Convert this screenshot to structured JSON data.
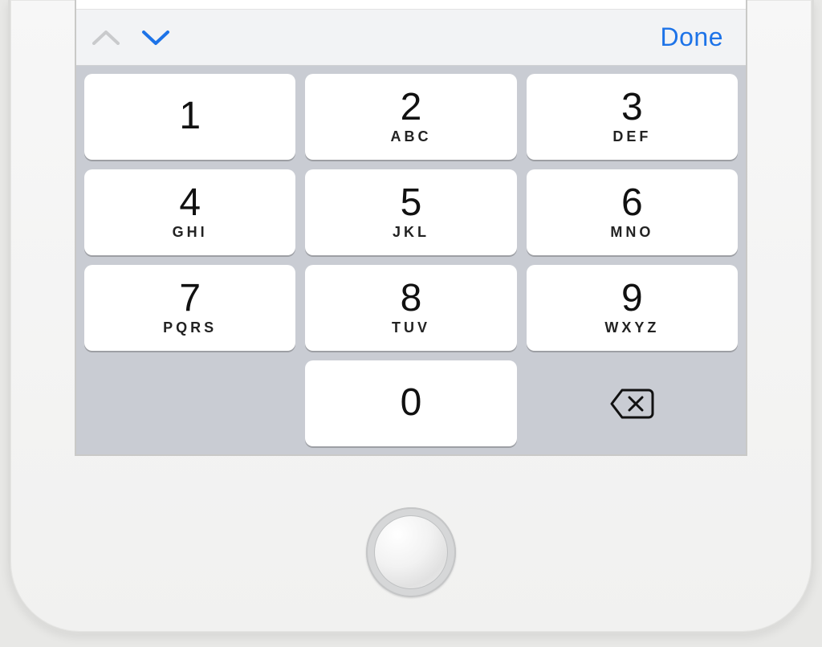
{
  "accessory": {
    "prev_icon": "chevron-up-icon",
    "next_icon": "chevron-down-icon",
    "done_label": "Done",
    "accent_color": "#1d73e8"
  },
  "keypad": {
    "keys": [
      {
        "digit": "1",
        "letters": ""
      },
      {
        "digit": "2",
        "letters": "ABC"
      },
      {
        "digit": "3",
        "letters": "DEF"
      },
      {
        "digit": "4",
        "letters": "GHI"
      },
      {
        "digit": "5",
        "letters": "JKL"
      },
      {
        "digit": "6",
        "letters": "MNO"
      },
      {
        "digit": "7",
        "letters": "PQRS"
      },
      {
        "digit": "8",
        "letters": "TUV"
      },
      {
        "digit": "9",
        "letters": "WXYZ"
      },
      {
        "digit": "0",
        "letters": ""
      }
    ],
    "backspace_icon": "backspace-icon"
  },
  "hardware": {
    "home_button": "home-button"
  }
}
